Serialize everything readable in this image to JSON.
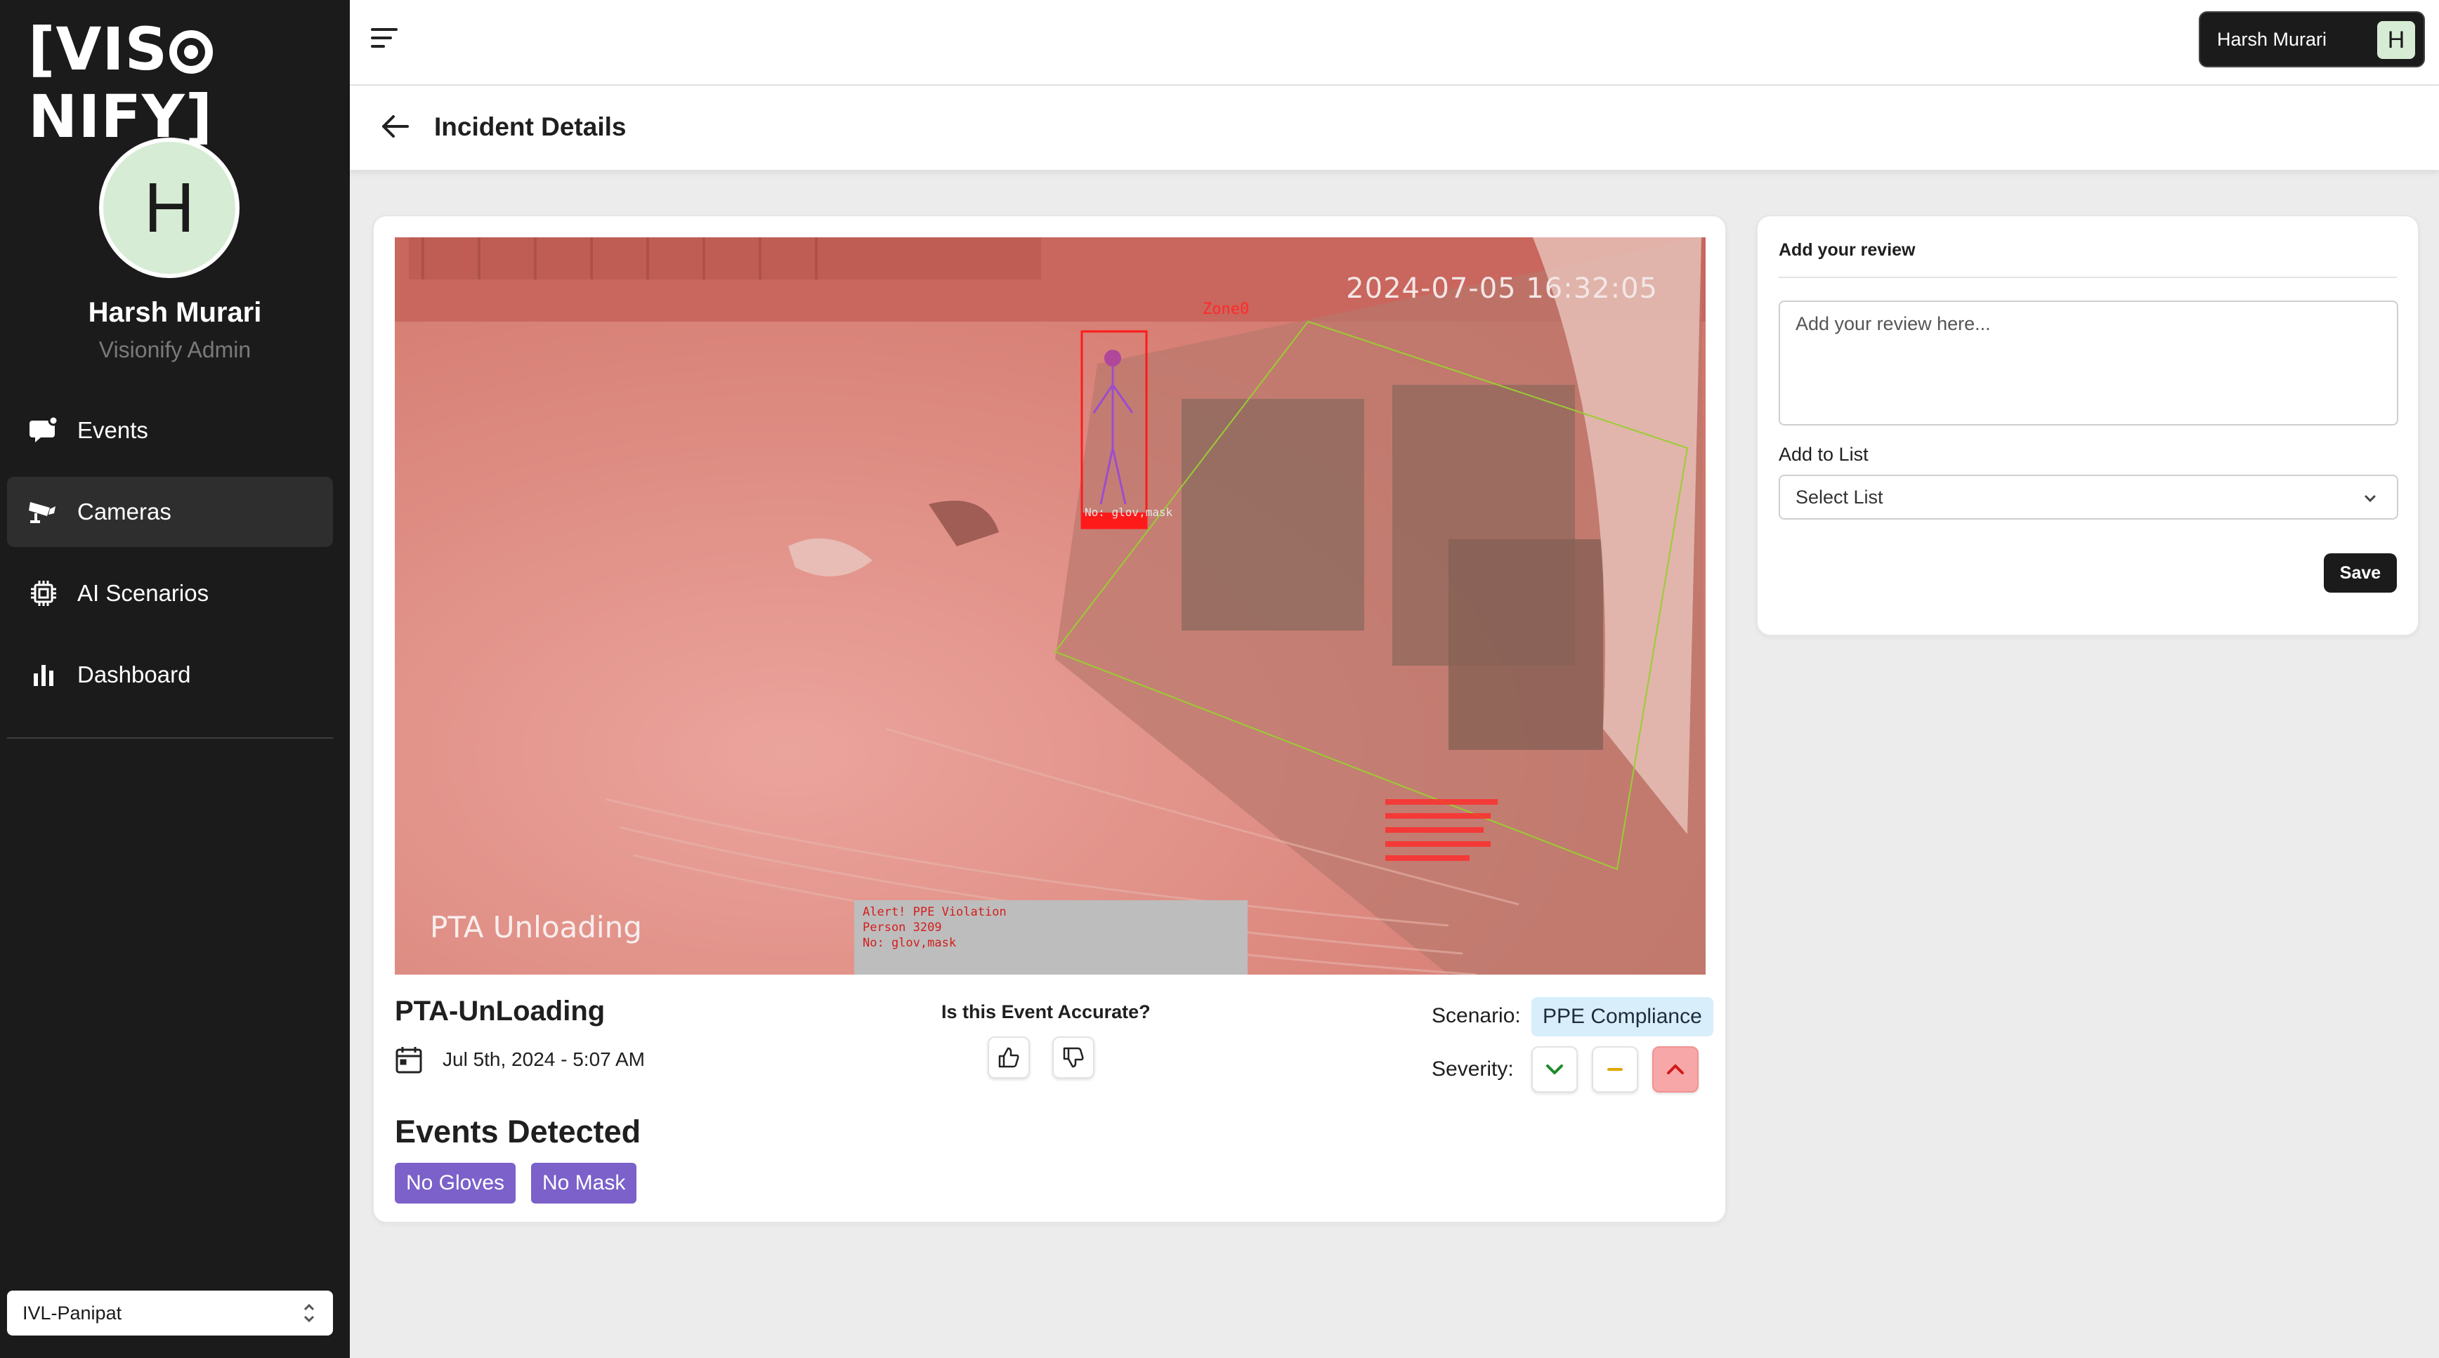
{
  "brand": {
    "logo_left": "[VIS",
    "logo_right": "NIFY]"
  },
  "user": {
    "initial": "H",
    "name": "Harsh Murari",
    "role": "Visionify Admin"
  },
  "nav": [
    {
      "label": "Events",
      "icon": "events-icon"
    },
    {
      "label": "Cameras",
      "icon": "camera-icon",
      "active": true
    },
    {
      "label": "AI Scenarios",
      "icon": "chip-icon"
    },
    {
      "label": "Dashboard",
      "icon": "bar-chart-icon"
    }
  ],
  "site_selector": {
    "value": "IVL-Panipat"
  },
  "topbar": {
    "user_name": "Harsh Murari",
    "user_initial": "H"
  },
  "page": {
    "title": "Incident Details"
  },
  "video": {
    "timestamp": "2024-07-05 16:32:05",
    "camera_overlay": "PTA Unloading",
    "zone_label": "Zone0",
    "person_label": "No: glov,mask",
    "alert_lines": [
      "Alert! PPE Violation",
      "Person 3209",
      "No: glov,mask"
    ]
  },
  "incident": {
    "name": "PTA-UnLoading",
    "datetime": "Jul 5th, 2024 - 5:07 AM",
    "accuracy_question": "Is this Event Accurate?",
    "scenario_label": "Scenario:",
    "scenario": "PPE Compliance",
    "severity_label": "Severity:",
    "severity_selected": "high",
    "events_title": "Events Detected",
    "events": [
      "No Gloves",
      "No Mask"
    ]
  },
  "review": {
    "title": "Add your review",
    "placeholder": "Add your review here...",
    "list_label": "Add to List",
    "list_placeholder": "Select List",
    "save_label": "Save"
  },
  "colors": {
    "sidebar": "#1b1b1b",
    "accent_purple": "#7b61c9",
    "scenario_badge": "#d8eefb",
    "severity_high": "#f7a7a7",
    "avatar_green": "#d6ecd4"
  }
}
